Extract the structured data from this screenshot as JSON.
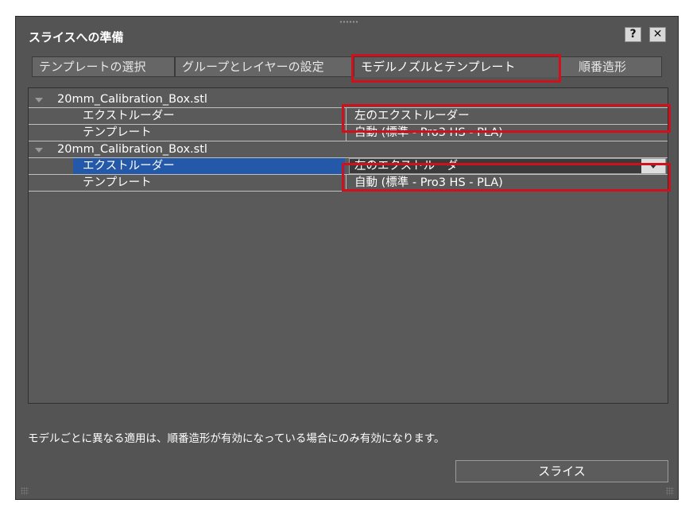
{
  "dialog": {
    "title": "スライスへの準備",
    "help_label": "?",
    "close_label": "✕"
  },
  "tabs": [
    {
      "label": "テンプレートの選択",
      "active": false
    },
    {
      "label": "グループとレイヤーの設定",
      "active": false
    },
    {
      "label": "モデルノズルとテンプレート",
      "active": true
    },
    {
      "label": "順番造形",
      "active": false
    }
  ],
  "tree": {
    "groups": [
      {
        "name": "20mm_Calibration_Box.stl",
        "props": [
          {
            "label": "エクストルーダー",
            "value": "左のエクストルーダー"
          },
          {
            "label": "テンプレート",
            "value": "自動 (標準 - Pro3 HS - PLA)"
          }
        ]
      },
      {
        "name": "20mm_Calibration_Box.stl",
        "props": [
          {
            "label": "エクストルーダー",
            "value": "左のエクストルーダー"
          },
          {
            "label": "テンプレート",
            "value": "自動 (標準 - Pro3 HS - PLA)"
          }
        ]
      }
    ]
  },
  "footer": {
    "note": "モデルごとに異なる適用は、順番造形が有効になっている場合にのみ有効になります。",
    "slice_label": "スライス"
  },
  "colors": {
    "highlight": "#d0101a",
    "selection": "#2458a8"
  }
}
